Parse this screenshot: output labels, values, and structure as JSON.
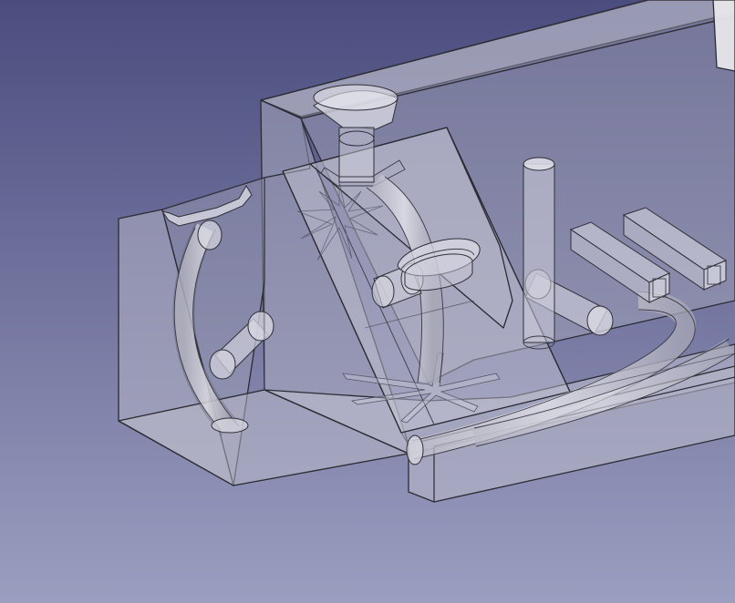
{
  "view": {
    "type": "3d-cad-viewport",
    "display_mode": "transparent-shaded",
    "background_top_color": "#4a4d7e",
    "background_bottom_color": "#9c9ec0"
  },
  "model": {
    "face_color": "#c8c8d0",
    "edge_color": "#2b2b33",
    "transparency": 0.55
  },
  "features": [
    {
      "name": "main-block",
      "icon": "box"
    },
    {
      "name": "side-ramp-block",
      "icon": "wedge"
    },
    {
      "name": "funnel-inlet",
      "icon": "cone"
    },
    {
      "name": "inclined-channel-plate",
      "icon": "plane"
    },
    {
      "name": "vertical-pillar",
      "icon": "cylinder"
    },
    {
      "name": "square-tube-left",
      "icon": "square-tube"
    },
    {
      "name": "square-tube-right",
      "icon": "square-tube"
    },
    {
      "name": "curved-pipe-left",
      "icon": "pipe"
    },
    {
      "name": "curved-pipe-front",
      "icon": "pipe"
    },
    {
      "name": "star-pattern-upper",
      "icon": "star"
    },
    {
      "name": "star-pattern-lower",
      "icon": "star"
    },
    {
      "name": "slot-opening",
      "icon": "slot"
    }
  ]
}
